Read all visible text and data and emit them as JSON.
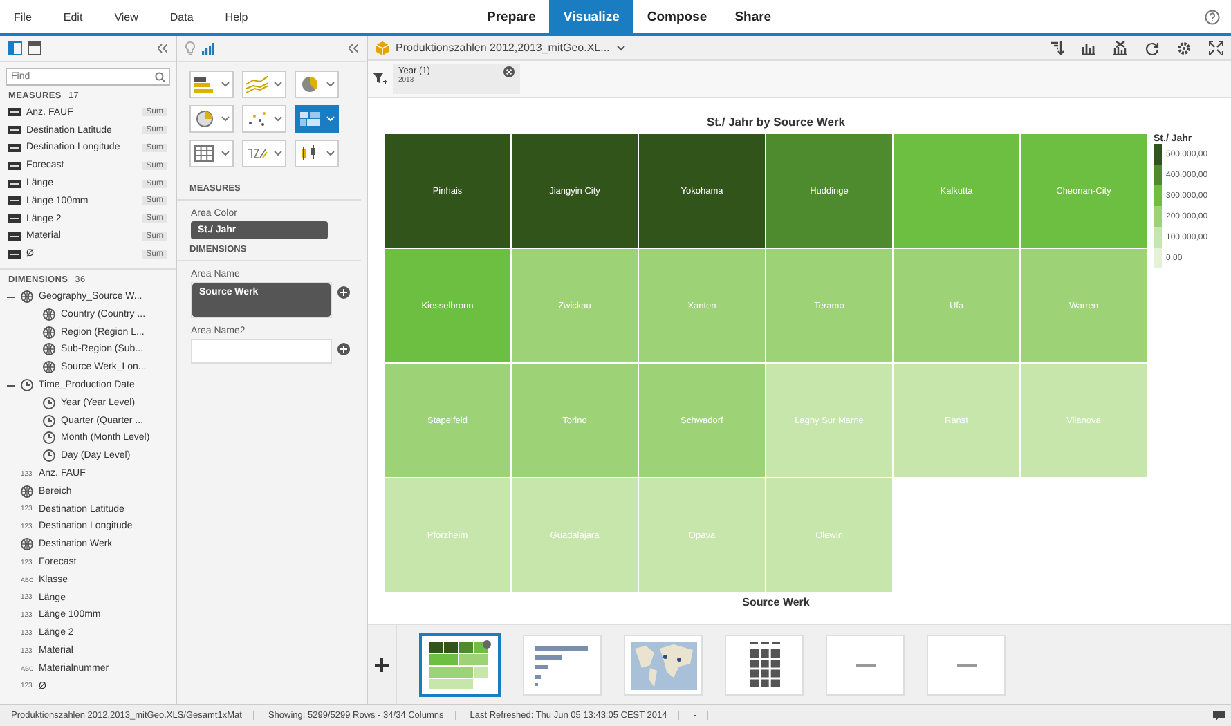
{
  "menu": [
    {
      "label": "File"
    },
    {
      "label": "Edit"
    },
    {
      "label": "View"
    },
    {
      "label": "Data"
    },
    {
      "label": "Help"
    }
  ],
  "tabs": [
    {
      "label": "Prepare",
      "selected": false
    },
    {
      "label": "Visualize",
      "selected": true
    },
    {
      "label": "Compose",
      "selected": false
    },
    {
      "label": "Share",
      "selected": false
    }
  ],
  "left_panel": {
    "search": {
      "placeholder": "Find"
    },
    "measures": {
      "title": "MEASURES",
      "count": "17",
      "items": [
        {
          "name": "Anz. FAUF",
          "aggregation": "Sum"
        },
        {
          "name": "Destination Latitude",
          "aggregation": "Sum"
        },
        {
          "name": "Destination Longitude",
          "aggregation": "Sum"
        },
        {
          "name": "Forecast",
          "aggregation": "Sum"
        },
        {
          "name": "Länge",
          "aggregation": "Sum"
        },
        {
          "name": "Länge 100mm",
          "aggregation": "Sum"
        },
        {
          "name": "Länge 2",
          "aggregation": "Sum"
        },
        {
          "name": "Material",
          "aggregation": "Sum"
        },
        {
          "name": "Ø",
          "aggregation": "Sum"
        }
      ]
    },
    "dimensions": {
      "title": "DIMENSIONS",
      "count": "36",
      "items": [
        {
          "name": "Geography_Source W...",
          "kind": "geo",
          "expanded": true,
          "children": [
            {
              "name": "Country (Country ...",
              "kind": "geo"
            },
            {
              "name": "Region (Region L...",
              "kind": "geo"
            },
            {
              "name": "Sub-Region (Sub...",
              "kind": "geo"
            },
            {
              "name": "Source Werk_Lon...",
              "kind": "geo"
            }
          ]
        },
        {
          "name": "Time_Production Date",
          "kind": "time",
          "expanded": true,
          "children": [
            {
              "name": "Year (Year Level)",
              "kind": "time"
            },
            {
              "name": "Quarter (Quarter ...",
              "kind": "time"
            },
            {
              "name": "Month (Month Level)",
              "kind": "time"
            },
            {
              "name": "Day (Day Level)",
              "kind": "time"
            }
          ]
        },
        {
          "name": "Anz. FAUF",
          "kind": "number",
          "type_label": "123"
        },
        {
          "name": "Bereich",
          "kind": "geo"
        },
        {
          "name": "Destination Latitude",
          "kind": "number",
          "type_label": "123"
        },
        {
          "name": "Destination Longitude",
          "kind": "number",
          "type_label": "123"
        },
        {
          "name": "Destination Werk",
          "kind": "geo"
        },
        {
          "name": "Forecast",
          "kind": "number",
          "type_label": "123"
        },
        {
          "name": "Klasse",
          "kind": "text",
          "type_label": "ABC"
        },
        {
          "name": "Länge",
          "kind": "number",
          "type_label": "123"
        },
        {
          "name": "Länge 100mm",
          "kind": "number",
          "type_label": "123"
        },
        {
          "name": "Länge 2",
          "kind": "number",
          "type_label": "123"
        },
        {
          "name": "Material",
          "kind": "number",
          "type_label": "123"
        },
        {
          "name": "Materialnummer",
          "kind": "text",
          "type_label": "ABC"
        },
        {
          "name": "Ø",
          "kind": "number",
          "type_label": "123"
        }
      ]
    }
  },
  "builder": {
    "chart_types": [
      {
        "kind": "bar",
        "selected": false
      },
      {
        "kind": "line",
        "selected": false
      },
      {
        "kind": "pie",
        "selected": false
      },
      {
        "kind": "geo",
        "selected": false
      },
      {
        "kind": "scatter",
        "selected": false
      },
      {
        "kind": "heatmap",
        "selected": true
      },
      {
        "kind": "table",
        "selected": false
      },
      {
        "kind": "number",
        "selected": false
      },
      {
        "kind": "boxplot",
        "selected": false
      }
    ],
    "measures_title": "MEASURES",
    "area_color_label": "Area Color",
    "area_color_value": "St./ Jahr",
    "dimensions_title": "DIMENSIONS",
    "area_name_label": "Area Name",
    "area_name_value": "Source Werk",
    "area_name2_label": "Area Name2"
  },
  "main": {
    "dataset": "Produktionszahlen 2012,2013_mitGeo.XL...",
    "filter": {
      "label": "Year (1)",
      "value": "2013"
    },
    "chart": {
      "title": "St./ Jahr by Source Werk",
      "xlabel": "Source Werk",
      "tiles": [
        {
          "name": "Pinhais",
          "color": "#31541b"
        },
        {
          "name": "Jiangyin City",
          "color": "#31541b"
        },
        {
          "name": "Yokohama",
          "color": "#31541b"
        },
        {
          "name": "Huddinge",
          "color": "#4e8b2e"
        },
        {
          "name": "Kalkutta",
          "color": "#6cbf40"
        },
        {
          "name": "Cheonan-City",
          "color": "#6cbf40"
        },
        {
          "name": "Kiesselbronn",
          "color": "#6cbf40"
        },
        {
          "name": "Zwickau",
          "color": "#9dd276"
        },
        {
          "name": "Xanten",
          "color": "#9dd276"
        },
        {
          "name": "Teramo",
          "color": "#9dd276"
        },
        {
          "name": "Ufa",
          "color": "#9dd276"
        },
        {
          "name": "Warren",
          "color": "#9dd276"
        },
        {
          "name": "Stapelfeld",
          "color": "#9dd276"
        },
        {
          "name": "Torino",
          "color": "#9dd276"
        },
        {
          "name": "Schwadorf",
          "color": "#9dd276"
        },
        {
          "name": "Lagny Sur Marne",
          "color": "#c6e6ab"
        },
        {
          "name": "Ranst",
          "color": "#c6e6ab"
        },
        {
          "name": "Vilanova",
          "color": "#c6e6ab"
        },
        {
          "name": "Pforzheim",
          "color": "#c6e6ab"
        },
        {
          "name": "Guadalajara",
          "color": "#c6e6ab"
        },
        {
          "name": "Opava",
          "color": "#c6e6ab"
        },
        {
          "name": "Olewin",
          "color": "#c6e6ab"
        }
      ],
      "legend": {
        "title": "St./ Jahr",
        "items": [
          {
            "label": "500.000,00",
            "color": "#31541b"
          },
          {
            "label": "400.000,00",
            "color": "#4e8b2e"
          },
          {
            "label": "300.000,00",
            "color": "#6cbf40"
          },
          {
            "label": "200.000,00",
            "color": "#9dd276"
          },
          {
            "label": "100.000,00",
            "color": "#c6e6ab"
          },
          {
            "label": "0,00",
            "color": "#e4f2d6"
          }
        ]
      }
    },
    "thumbnails": [
      {
        "kind": "heatmap",
        "selected": true
      },
      {
        "kind": "bar",
        "selected": false
      },
      {
        "kind": "map",
        "selected": false
      },
      {
        "kind": "table",
        "selected": false
      },
      {
        "kind": "number",
        "selected": false
      },
      {
        "kind": "number",
        "selected": false
      }
    ]
  },
  "status_bar": {
    "source": "Produktionszahlen 2012,2013_mitGeo.XLS/Gesamt1xMat",
    "showing": "Showing: 5299/5299 Rows - 34/34 Columns",
    "refreshed": "Last Refreshed: Thu Jun 05 13:43:05 CEST 2014",
    "extra": "-"
  }
}
